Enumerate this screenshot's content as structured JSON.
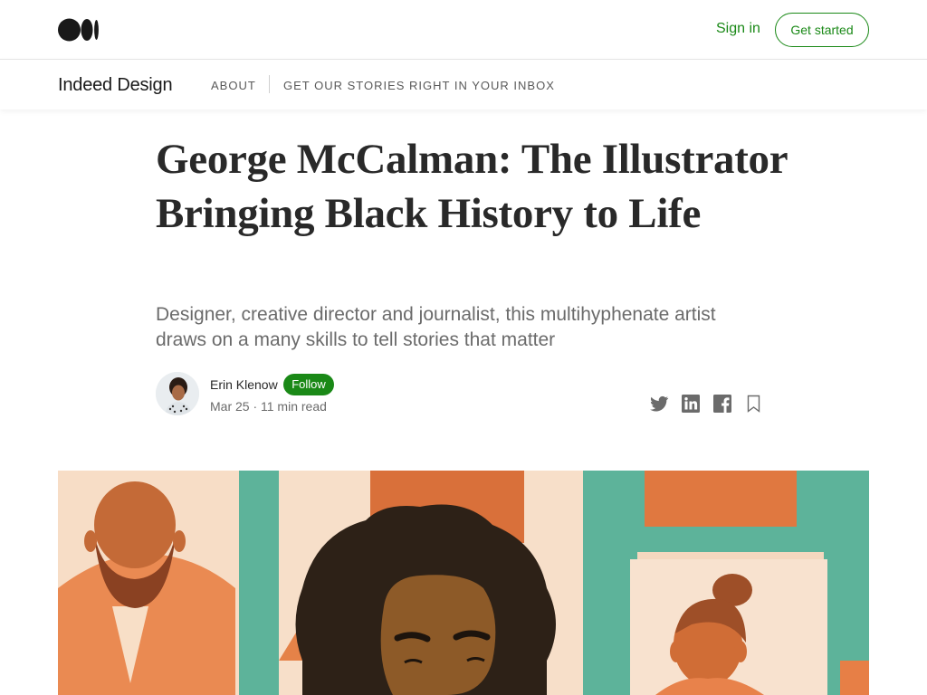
{
  "header": {
    "signin_label": "Sign in",
    "get_started_label": "Get started"
  },
  "publication": {
    "name": "Indeed Design",
    "nav": [
      "ABOUT",
      "GET OUR STORIES RIGHT IN YOUR INBOX"
    ]
  },
  "article": {
    "title": "George McCalman: The Illustrator Bringing Black History to Life",
    "subtitle": "Designer, creative director and journalist, this multihyphenate artist draws on a many skills to tell stories that matter",
    "author": "Erin Klenow",
    "follow_label": "Follow",
    "meta": "Mar 25 · 11 min read"
  },
  "share_icons": [
    "twitter-icon",
    "linkedin-icon",
    "facebook-icon",
    "bookmark-icon"
  ],
  "colors": {
    "accent_green": "#1a8917",
    "text": "#292929",
    "muted": "#6b6b6b"
  }
}
